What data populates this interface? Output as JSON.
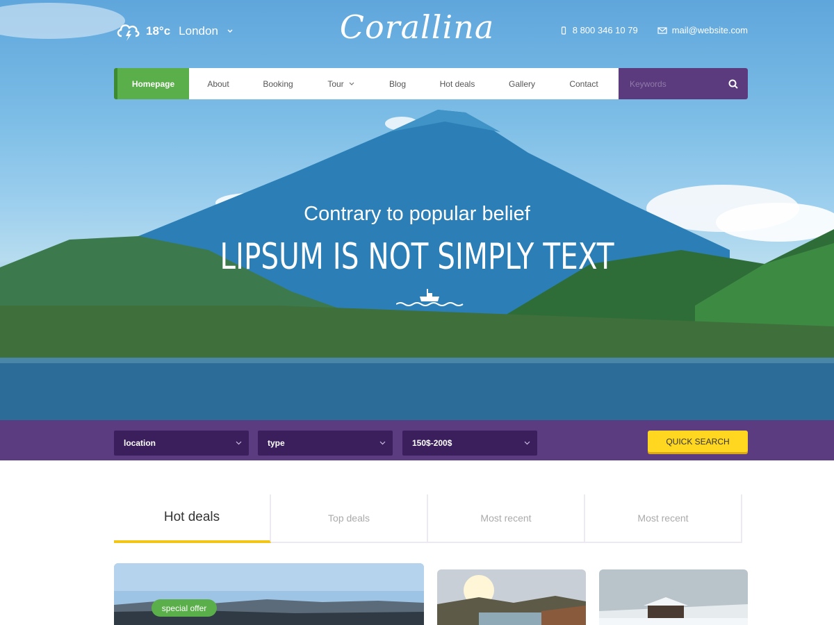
{
  "header": {
    "weather": {
      "icon": "storm-cloud-icon",
      "temperature": "18°c",
      "city": "London"
    },
    "logo": "Corallina",
    "phone": "8 800 346 10 79",
    "email": "mail@website.com"
  },
  "nav": {
    "items": [
      {
        "label": "Homepage",
        "active": true
      },
      {
        "label": "About"
      },
      {
        "label": "Booking"
      },
      {
        "label": "Tour"
      },
      {
        "label": "Blog"
      },
      {
        "label": "Hot deals"
      },
      {
        "label": "Gallery"
      },
      {
        "label": "Contact"
      }
    ],
    "search_placeholder": "Keywords"
  },
  "hero": {
    "subtitle": "Contrary to popular belief",
    "title": "LIPSUM IS NOT SIMPLY TEXT"
  },
  "quick_search": {
    "location": "location",
    "type": "type",
    "price": "150$-200$",
    "button": "QUICK SEARCH"
  },
  "tabs": [
    "Hot deals",
    "Top deals",
    "Most recent",
    "Most recent"
  ],
  "cards": {
    "badge": "special offer"
  },
  "colors": {
    "accent_green": "#5aaf4b",
    "purple": "#5c3c80",
    "dark_purple": "#3b1f5c",
    "yellow": "#ffd620"
  }
}
